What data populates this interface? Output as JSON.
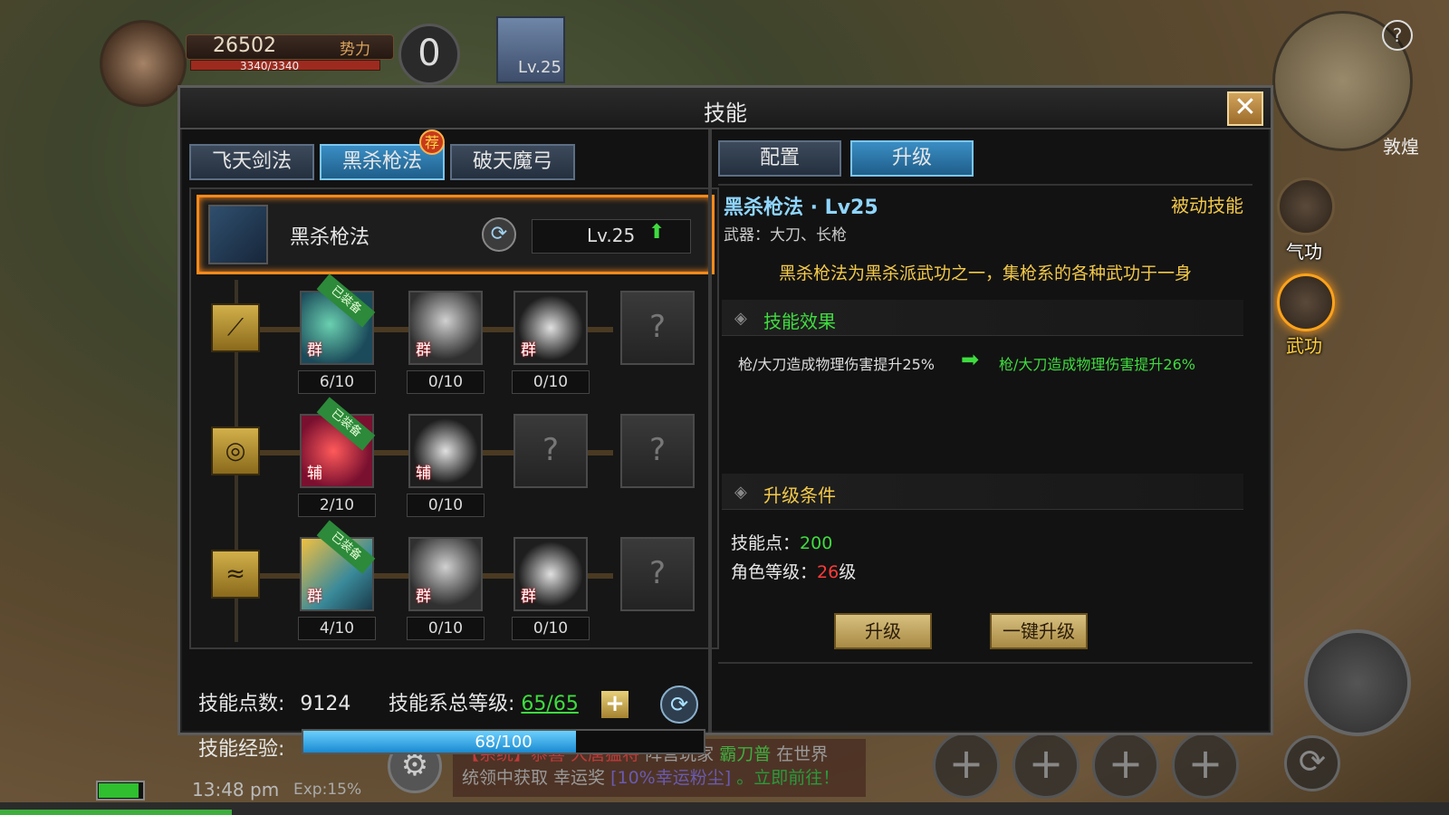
{
  "hud": {
    "power": "26502",
    "power_tag": "势力",
    "hp": "3340/3340",
    "kills": "0",
    "pet_level": "Lv.25",
    "map_name": "敦煌",
    "help": "?",
    "time": "13:48 pm",
    "exp": "Exp:15%",
    "exp_bar_fraction": 0.16,
    "chat_line1_a": "【系统】恭喜",
    "chat_line1_b": "大唐猛将",
    "chat_line1_c": "阵营玩家",
    "chat_line1_d": "霸刀普",
    "chat_line1_e": "在世界",
    "chat_line2_a": "统领中获取 幸运奖",
    "chat_line2_b": "[10%幸运粉尘]",
    "chat_line2_c": "。立即前往！",
    "slot_plus": "+",
    "gear": "⚙",
    "refresh": "⟳"
  },
  "side": {
    "qigong": "气功",
    "wugong": "武功"
  },
  "dialog": {
    "title": "技能",
    "close": "✕",
    "tabs": [
      "飞天剑法",
      "黑杀枪法",
      "破天魔弓"
    ],
    "rec_badge": "荐",
    "skill_name": "黑杀枪法",
    "skill_level": "Lv.25",
    "up_arrow": "⬆",
    "swap": "⟳",
    "rows": [
      {
        "icon": "⟋",
        "counts": [
          "6/10",
          "0/10",
          "0/10"
        ]
      },
      {
        "icon": "◎",
        "counts": [
          "2/10",
          "0/10"
        ]
      },
      {
        "icon": "≈",
        "counts": [
          "4/10",
          "0/10",
          "0/10"
        ]
      }
    ],
    "tag_group": "群",
    "tag_aux": "辅",
    "equipped": "已装备",
    "lock": "?",
    "points_label": "技能点数:",
    "points_value": "9124",
    "total_label": "技能系总等级:",
    "total_value": "65/65",
    "plus": "+",
    "reset": "⟳",
    "exp_label": "技能经验:",
    "exp_value": "68/100",
    "exp_fraction": 0.68
  },
  "detail": {
    "tabs": [
      "配置",
      "升级"
    ],
    "title": "黑杀枪法 · Lv25",
    "type": "被动技能",
    "weapon": "武器：大刀、长枪",
    "desc": "黑杀枪法为黑杀派武功之一，集枪系的各种武功于一身",
    "effect_title": "技能效果",
    "effect_old": "枪/大刀造成物理伤害提升25%",
    "arrow": "➡",
    "effect_new": "枪/大刀造成物理伤害提升26%",
    "cond_title": "升级条件",
    "cond_points_label": "技能点：",
    "cond_points_value": "200",
    "cond_level_label": "角色等级：",
    "cond_level_value": "26",
    "cond_level_unit": "级",
    "diamond": "◈",
    "upgrade_btn": "升级",
    "oneclick_btn": "一键升级"
  }
}
